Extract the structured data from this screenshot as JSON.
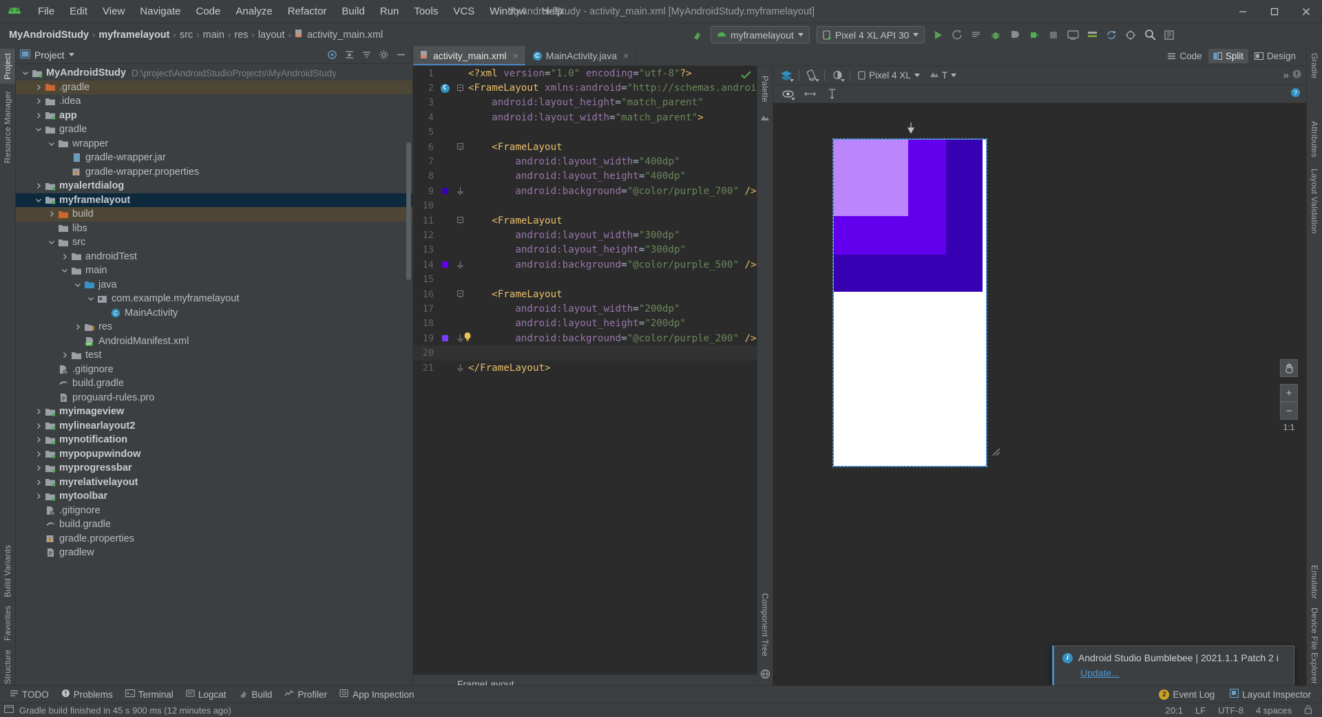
{
  "window": {
    "title": "MyAndroidStudy - activity_main.xml [MyAndroidStudy.myframelayout]",
    "minimize_icon": "minimize-icon",
    "maximize_icon": "maximize-icon",
    "close_icon": "close-icon"
  },
  "menubar": {
    "logo": "android-logo-icon",
    "items": [
      "File",
      "Edit",
      "View",
      "Navigate",
      "Code",
      "Analyze",
      "Refactor",
      "Build",
      "Run",
      "Tools",
      "VCS",
      "Window",
      "Help"
    ]
  },
  "breadcrumb": {
    "items": [
      "MyAndroidStudy",
      "myframelayout",
      "src",
      "main",
      "res",
      "layout",
      "activity_main.xml"
    ],
    "separator": "›"
  },
  "toolbar": {
    "module_selector": "myframelayout",
    "device_selector": "Pixel 4 XL API 30",
    "icons": [
      "run-icon",
      "apply-changes-icon",
      "apply-code-changes-icon",
      "debug-icon",
      "run-with-profiler-icon",
      "attach-debugger-icon",
      "stop-icon",
      "avd-manager-icon",
      "sdk-manager-icon",
      "sync-gradle-icon",
      "layout-editor-icon",
      "search-icon",
      "make-project-icon"
    ]
  },
  "left_strip": {
    "tabs": [
      "Project",
      "Resource Manager"
    ],
    "bottom_tabs": [
      "Structure",
      "Favorites",
      "Build Variants"
    ]
  },
  "right_strip": {
    "tabs": [
      "Gradle",
      "Attributes",
      "Layout Validation",
      "Device File Explorer",
      "Emulator"
    ]
  },
  "project_panel": {
    "title": "Project",
    "header_icons": [
      "expand-all-icon",
      "collapse-all-icon",
      "sort-icon",
      "settings-icon",
      "hide-icon"
    ],
    "tree": [
      {
        "label": "MyAndroidStudy",
        "path": "D:\\project\\AndroidStudioProjects\\MyAndroidStudy",
        "indent": 0,
        "arrow": "down",
        "icon": "module-folder",
        "bold": true
      },
      {
        "label": ".gradle",
        "indent": 1,
        "arrow": "right",
        "icon": "excluded-folder",
        "highlight": "amber"
      },
      {
        "label": ".idea",
        "indent": 1,
        "arrow": "right",
        "icon": "folder"
      },
      {
        "label": "app",
        "indent": 1,
        "arrow": "right",
        "icon": "module-folder",
        "bold": true
      },
      {
        "label": "gradle",
        "indent": 1,
        "arrow": "down",
        "icon": "folder"
      },
      {
        "label": "wrapper",
        "indent": 2,
        "arrow": "down",
        "icon": "folder"
      },
      {
        "label": "gradle-wrapper.jar",
        "indent": 3,
        "arrow": "none",
        "icon": "jar-file"
      },
      {
        "label": "gradle-wrapper.properties",
        "indent": 3,
        "arrow": "none",
        "icon": "properties-file"
      },
      {
        "label": "myalertdialog",
        "indent": 1,
        "arrow": "right",
        "icon": "module-folder",
        "bold": true
      },
      {
        "label": "myframelayout",
        "indent": 1,
        "arrow": "down",
        "icon": "module-folder",
        "bold": true,
        "highlight": "selected"
      },
      {
        "label": "build",
        "indent": 2,
        "arrow": "right",
        "icon": "excluded-folder",
        "highlight": "amber"
      },
      {
        "label": "libs",
        "indent": 2,
        "arrow": "none",
        "icon": "folder"
      },
      {
        "label": "src",
        "indent": 2,
        "arrow": "down",
        "icon": "folder"
      },
      {
        "label": "androidTest",
        "indent": 3,
        "arrow": "right",
        "icon": "folder"
      },
      {
        "label": "main",
        "indent": 3,
        "arrow": "down",
        "icon": "folder"
      },
      {
        "label": "java",
        "indent": 4,
        "arrow": "down",
        "icon": "source-folder"
      },
      {
        "label": "com.example.myframelayout",
        "indent": 5,
        "arrow": "down",
        "icon": "package"
      },
      {
        "label": "MainActivity",
        "indent": 6,
        "arrow": "none",
        "icon": "java-class"
      },
      {
        "label": "res",
        "indent": 4,
        "arrow": "right",
        "icon": "res-folder"
      },
      {
        "label": "AndroidManifest.xml",
        "indent": 4,
        "arrow": "none",
        "icon": "manifest-file"
      },
      {
        "label": "test",
        "indent": 3,
        "arrow": "right",
        "icon": "folder"
      },
      {
        "label": ".gitignore",
        "indent": 2,
        "arrow": "none",
        "icon": "gitignore-file"
      },
      {
        "label": "build.gradle",
        "indent": 2,
        "arrow": "none",
        "icon": "gradle-file"
      },
      {
        "label": "proguard-rules.pro",
        "indent": 2,
        "arrow": "none",
        "icon": "text-file"
      },
      {
        "label": "myimageview",
        "indent": 1,
        "arrow": "right",
        "icon": "module-folder",
        "bold": true
      },
      {
        "label": "mylinearlayout2",
        "indent": 1,
        "arrow": "right",
        "icon": "module-folder",
        "bold": true
      },
      {
        "label": "mynotification",
        "indent": 1,
        "arrow": "right",
        "icon": "module-folder",
        "bold": true
      },
      {
        "label": "mypopupwindow",
        "indent": 1,
        "arrow": "right",
        "icon": "module-folder",
        "bold": true
      },
      {
        "label": "myprogressbar",
        "indent": 1,
        "arrow": "right",
        "icon": "module-folder",
        "bold": true
      },
      {
        "label": "myrelativelayout",
        "indent": 1,
        "arrow": "right",
        "icon": "module-folder",
        "bold": true
      },
      {
        "label": "mytoolbar",
        "indent": 1,
        "arrow": "right",
        "icon": "module-folder",
        "bold": true
      },
      {
        "label": ".gitignore",
        "indent": 1,
        "arrow": "none",
        "icon": "gitignore-file"
      },
      {
        "label": "build.gradle",
        "indent": 1,
        "arrow": "none",
        "icon": "gradle-file"
      },
      {
        "label": "gradle.properties",
        "indent": 1,
        "arrow": "none",
        "icon": "properties-file"
      },
      {
        "label": "gradlew",
        "indent": 1,
        "arrow": "none",
        "icon": "text-file"
      }
    ]
  },
  "editor": {
    "tabs": [
      {
        "label": "activity_main.xml",
        "icon": "layout-xml-icon",
        "active": true,
        "close": "×"
      },
      {
        "label": "MainActivity.java",
        "icon": "java-class-icon",
        "active": false,
        "close": "×"
      }
    ],
    "view_modes": [
      {
        "label": "Code",
        "icon": "code-mode-icon",
        "active": false
      },
      {
        "label": "Split",
        "icon": "split-mode-icon",
        "active": true
      },
      {
        "label": "Design",
        "icon": "design-mode-icon",
        "active": false
      }
    ],
    "inspection_status": "ok-check",
    "component_label": "FrameLayout",
    "lines": [
      {
        "n": 1,
        "tokens": [
          {
            "t": "<?xml ",
            "c": "proc"
          },
          {
            "t": "version",
            "c": "attr"
          },
          {
            "t": "=",
            "c": "punct"
          },
          {
            "t": "\"1.0\"",
            "c": "str"
          },
          {
            "t": " ",
            "c": "punct"
          },
          {
            "t": "encoding",
            "c": "attr"
          },
          {
            "t": "=",
            "c": "punct"
          },
          {
            "t": "\"utf-8\"",
            "c": "str"
          },
          {
            "t": "?>",
            "c": "proc"
          }
        ],
        "indent": 0
      },
      {
        "n": 2,
        "tokens": [
          {
            "t": "<FrameLayout",
            "c": "tag"
          },
          {
            "t": " ",
            "c": "punct"
          },
          {
            "t": "xmlns:android",
            "c": "attr"
          },
          {
            "t": "=",
            "c": "punct"
          },
          {
            "t": "\"http://schemas.android.co",
            "c": "str"
          }
        ],
        "indent": 0,
        "gutter": "class-badge",
        "fold": "collapse-start"
      },
      {
        "n": 3,
        "tokens": [
          {
            "t": "android:layout_height",
            "c": "attr"
          },
          {
            "t": "=",
            "c": "punct"
          },
          {
            "t": "\"match_parent\"",
            "c": "str"
          }
        ],
        "indent": 1
      },
      {
        "n": 4,
        "tokens": [
          {
            "t": "android:layout_width",
            "c": "attr"
          },
          {
            "t": "=",
            "c": "punct"
          },
          {
            "t": "\"match_parent\"",
            "c": "str"
          },
          {
            "t": ">",
            "c": "tag"
          }
        ],
        "indent": 1
      },
      {
        "n": 5,
        "tokens": [],
        "indent": 0
      },
      {
        "n": 6,
        "tokens": [
          {
            "t": "<FrameLayout",
            "c": "tag"
          }
        ],
        "indent": 1,
        "fold": "collapse-start"
      },
      {
        "n": 7,
        "tokens": [
          {
            "t": "android:layout_width",
            "c": "attr"
          },
          {
            "t": "=",
            "c": "punct"
          },
          {
            "t": "\"400dp\"",
            "c": "str"
          }
        ],
        "indent": 2
      },
      {
        "n": 8,
        "tokens": [
          {
            "t": "android:layout_height",
            "c": "attr"
          },
          {
            "t": "=",
            "c": "punct"
          },
          {
            "t": "\"400dp\"",
            "c": "str"
          }
        ],
        "indent": 2
      },
      {
        "n": 9,
        "tokens": [
          {
            "t": "android:background",
            "c": "attr"
          },
          {
            "t": "=",
            "c": "punct"
          },
          {
            "t": "\"@color/purple_700\"",
            "c": "str"
          },
          {
            "t": " ",
            "c": "punct"
          },
          {
            "t": "/>",
            "c": "tag"
          }
        ],
        "indent": 2,
        "gutter": "color-swatch-700",
        "fold": "collapse-end"
      },
      {
        "n": 10,
        "tokens": [],
        "indent": 0
      },
      {
        "n": 11,
        "tokens": [
          {
            "t": "<FrameLayout",
            "c": "tag"
          }
        ],
        "indent": 1,
        "fold": "collapse-start"
      },
      {
        "n": 12,
        "tokens": [
          {
            "t": "android:layout_width",
            "c": "attr"
          },
          {
            "t": "=",
            "c": "punct"
          },
          {
            "t": "\"300dp\"",
            "c": "str"
          }
        ],
        "indent": 2
      },
      {
        "n": 13,
        "tokens": [
          {
            "t": "android:layout_height",
            "c": "attr"
          },
          {
            "t": "=",
            "c": "punct"
          },
          {
            "t": "\"300dp\"",
            "c": "str"
          }
        ],
        "indent": 2
      },
      {
        "n": 14,
        "tokens": [
          {
            "t": "android:background",
            "c": "attr"
          },
          {
            "t": "=",
            "c": "punct"
          },
          {
            "t": "\"@color/purple_500\"",
            "c": "str"
          },
          {
            "t": " ",
            "c": "punct"
          },
          {
            "t": "/>",
            "c": "tag"
          }
        ],
        "indent": 2,
        "gutter": "color-swatch-500",
        "fold": "collapse-end"
      },
      {
        "n": 15,
        "tokens": [],
        "indent": 0
      },
      {
        "n": 16,
        "tokens": [
          {
            "t": "<FrameLayout",
            "c": "tag"
          }
        ],
        "indent": 1,
        "fold": "collapse-start"
      },
      {
        "n": 17,
        "tokens": [
          {
            "t": "android:layout_width",
            "c": "attr"
          },
          {
            "t": "=",
            "c": "punct"
          },
          {
            "t": "\"200dp\"",
            "c": "str"
          }
        ],
        "indent": 2
      },
      {
        "n": 18,
        "tokens": [
          {
            "t": "android:layout_height",
            "c": "attr"
          },
          {
            "t": "=",
            "c": "punct"
          },
          {
            "t": "\"200dp\"",
            "c": "str"
          }
        ],
        "indent": 2
      },
      {
        "n": 19,
        "tokens": [
          {
            "t": "android:background",
            "c": "attr"
          },
          {
            "t": "=",
            "c": "punct"
          },
          {
            "t": "\"@color/purple_200\"",
            "c": "str"
          },
          {
            "t": " ",
            "c": "punct"
          },
          {
            "t": "/>",
            "c": "tag"
          }
        ],
        "indent": 2,
        "gutter": "color-swatch-200",
        "extra": "lightbulb",
        "fold": "collapse-end"
      },
      {
        "n": 20,
        "tokens": [],
        "indent": 0,
        "current": true
      },
      {
        "n": 21,
        "tokens": [
          {
            "t": "</FrameLayout>",
            "c": "tag"
          }
        ],
        "indent": 0,
        "fold": "collapse-end"
      }
    ]
  },
  "design": {
    "palette_label": "Palette",
    "component_tree_label": "Component Tree",
    "toolbar_icons": [
      "design-surface-icon",
      "orientation-icon",
      "theme-icon"
    ],
    "device": "Pixel 4 XL",
    "theme_label": "T",
    "overflow": "»",
    "warning_icon": "warning-icon",
    "row2_icons": [
      "eye-icon",
      "horizontal-constraint-icon",
      "vertical-constraint-icon"
    ],
    "help_icon": "help-icon",
    "pan_icon": "pan-hand-icon",
    "zoom_in": "+",
    "zoom_out": "−",
    "zoom_level": "1:1",
    "layers": [
      {
        "name": "purple_700",
        "color": "#3700b3",
        "size": "400dp"
      },
      {
        "name": "purple_500",
        "color": "#6200ee",
        "size": "300dp"
      },
      {
        "name": "purple_200",
        "color": "#bb86fc",
        "size": "200dp"
      }
    ]
  },
  "balloon": {
    "icon": "info-icon",
    "title": "Android Studio Bumblebee | 2021.1.1 Patch 2 i",
    "link": "Update..."
  },
  "bottom_bar": {
    "items": [
      {
        "label": "TODO",
        "icon": "todo-icon"
      },
      {
        "label": "Problems",
        "icon": "problems-icon"
      },
      {
        "label": "Terminal",
        "icon": "terminal-icon"
      },
      {
        "label": "Logcat",
        "icon": "logcat-icon"
      },
      {
        "label": "Build",
        "icon": "build-icon"
      },
      {
        "label": "Profiler",
        "icon": "profiler-icon"
      },
      {
        "label": "App Inspection",
        "icon": "app-inspection-icon"
      }
    ],
    "right_items": [
      {
        "label": "Event Log",
        "icon": "event-log-icon",
        "badge": "2"
      },
      {
        "label": "Layout Inspector",
        "icon": "layout-inspector-icon"
      }
    ]
  },
  "statusbar": {
    "message": "Gradle build finished in 45 s 900 ms (12 minutes ago)",
    "icon": "build-status-icon",
    "right": [
      "20:1",
      "LF",
      "UTF-8",
      "4 spaces"
    ],
    "lock_icon": "lock-icon"
  },
  "colors": {
    "accent": "#4a88c7",
    "purple_700": "#3700b3",
    "purple_500": "#6200ee",
    "purple_200": "#bb86fc",
    "selection": "#0d293e"
  }
}
